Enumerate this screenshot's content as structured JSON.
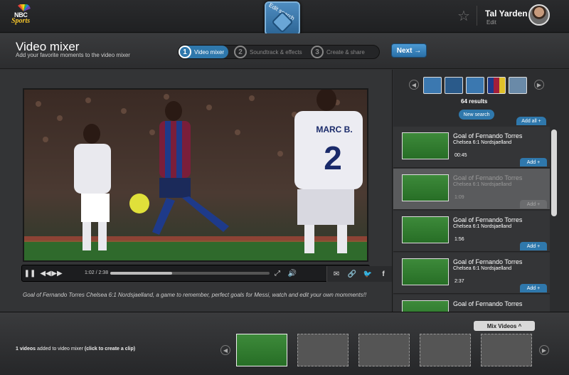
{
  "topbar": {
    "brand_line1": "NBC",
    "brand_line2": "Sports",
    "edit_search_label": "Edit search",
    "user_name": "Tal Yarden",
    "user_edit": "Edit"
  },
  "header": {
    "title": "Video mixer",
    "subtitle": "Add your favorite moments to the video mixer",
    "steps": [
      {
        "num": "1",
        "label": "Video mixer"
      },
      {
        "num": "2",
        "label": "Soundtrack & effects"
      },
      {
        "num": "3",
        "label": "Create & share"
      }
    ],
    "next_label": "Next →"
  },
  "player": {
    "jersey_name": "MARC B.",
    "jersey_number": "2",
    "time": "1:02 / 2:38",
    "progress": 0.39,
    "caption": "Goal of Fernando Torres Chelsea 6:1 Nordsjaelland, a game to remember, perfect goals for Messi, watch and edit your own momments!!"
  },
  "panel": {
    "results": "64 results",
    "new_search": "New search",
    "add_all": "Add all",
    "add_label": "Add",
    "items": [
      {
        "title": "Goal of Fernando Torres",
        "subtitle": "Chelsea 6:1 Nordsjaelland",
        "duration": "00:45"
      },
      {
        "title": "Goal of Fernando Torres",
        "subtitle": "Chelsea 6:1 Nordsjaelland",
        "duration": "1:09"
      },
      {
        "title": "Goal of Fernando Torres",
        "subtitle": "Chelsea 6:1 Nordsjaelland",
        "duration": "1:56"
      },
      {
        "title": "Goal of Fernando Torres",
        "subtitle": "Chelsea 6:1 Nordsjaelland",
        "duration": "2:37"
      },
      {
        "title": "Goal of Fernando Torres",
        "subtitle": "",
        "duration": ""
      }
    ]
  },
  "bottom": {
    "mix_videos": "Mix Videos ^",
    "added_count": "1 videos",
    "added_text": " added to video mixer ",
    "added_hint": "(click to create a clip)"
  }
}
